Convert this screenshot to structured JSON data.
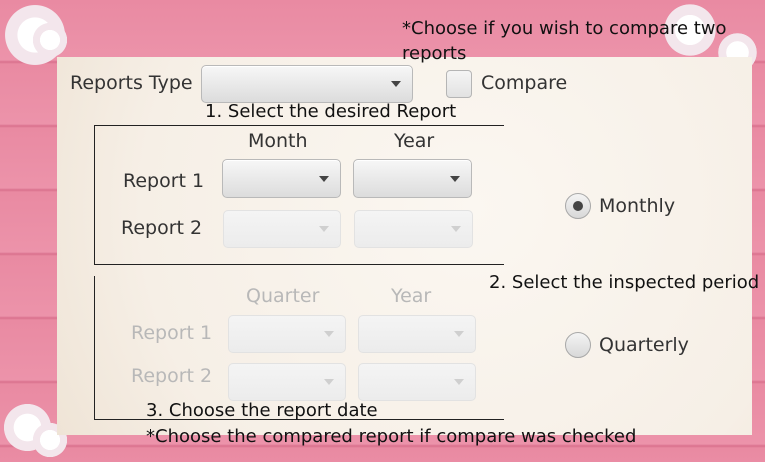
{
  "hint_compare": "*Choose if you wish to compare two reports",
  "reports_type_label": "Reports Type",
  "compare_label": "Compare",
  "step1": "1. Select the desired Report",
  "month_header": "Month",
  "year_header_1": "Year",
  "report1_label_a": "Report 1",
  "report2_label_a": "Report 2",
  "monthly_label": "Monthly",
  "step2": "2. Select the inspected period",
  "quarter_header": "Quarter",
  "year_header_2": "Year",
  "report1_label_b": "Report 1",
  "report2_label_b": "Report 2",
  "quarterly_label": "Quarterly",
  "step3": "3. Choose the report date",
  "footer_note": "*Choose the compared report if compare was checked",
  "period_selected": "Monthly"
}
